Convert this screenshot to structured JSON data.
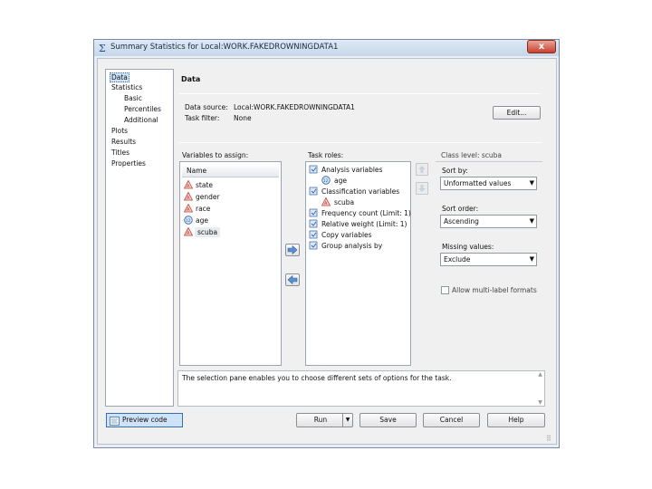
{
  "window": {
    "title": "Summary Statistics for Local:WORK.FAKEDROWNINGDATA1",
    "close_label": "x"
  },
  "nav": {
    "items": [
      {
        "label": "Data",
        "selected": true
      },
      {
        "label": "Statistics"
      },
      {
        "label": "Basic"
      },
      {
        "label": "Percentiles"
      },
      {
        "label": "Additional"
      },
      {
        "label": "Plots"
      },
      {
        "label": "Results"
      },
      {
        "label": "Titles"
      },
      {
        "label": "Properties"
      }
    ]
  },
  "data_panel": {
    "section_title": "Data",
    "data_source_label": "Data source:",
    "data_source_value": "Local:WORK.FAKEDROWNINGDATA1",
    "task_filter_label": "Task filter:",
    "task_filter_value": "None",
    "edit_button": "Edit..."
  },
  "variables": {
    "header": "Variables to assign:",
    "column": "Name",
    "items": [
      {
        "name": "state",
        "icon": "character-variable-icon"
      },
      {
        "name": "gender",
        "icon": "character-variable-icon"
      },
      {
        "name": "race",
        "icon": "character-variable-icon"
      },
      {
        "name": "age",
        "icon": "numeric-variable-icon"
      },
      {
        "name": "scuba",
        "icon": "character-variable-icon",
        "selected": true
      }
    ]
  },
  "task_roles": {
    "header": "Task roles:",
    "items": [
      {
        "label": "Analysis variables",
        "indent": 0
      },
      {
        "label": "age",
        "indent": 1
      },
      {
        "label": "Classification variables",
        "indent": 0
      },
      {
        "label": "scuba",
        "indent": 1
      },
      {
        "label": "Frequency count  (Limit: 1)",
        "indent": 0
      },
      {
        "label": "Relative weight  (Limit: 1)",
        "indent": 0
      },
      {
        "label": "Copy variables",
        "indent": 0
      },
      {
        "label": "Group analysis by",
        "indent": 0
      }
    ]
  },
  "class_level": {
    "header": "Class level: scuba",
    "sort_by_label": "Sort by:",
    "sort_by_value": "Unformatted values",
    "sort_order_label": "Sort order:",
    "sort_order_value": "Ascending",
    "missing_label": "Missing values:",
    "missing_value": "Exclude",
    "multilabel_label": "Allow multi-label formats",
    "multilabel_checked": false
  },
  "description": "The selection pane enables you to choose different sets of options for the task.",
  "footer": {
    "preview_label": "Preview code",
    "run_label": "Run",
    "save_label": "Save",
    "cancel_label": "Cancel",
    "help_label": "Help"
  },
  "colors": {
    "accent": "#3a6fb0",
    "character_icon": "#c0392b",
    "numeric_icon": "#2f5fa8"
  }
}
